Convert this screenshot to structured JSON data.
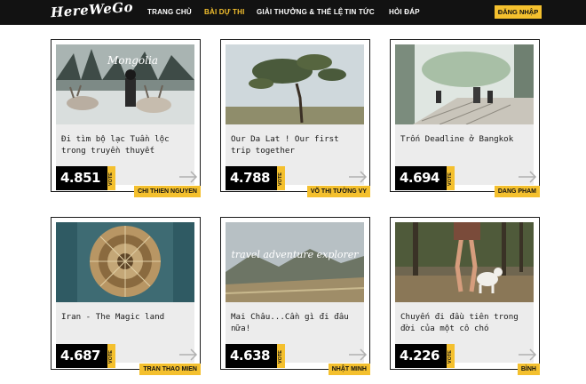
{
  "brand": {
    "logo_text": "HereWeGo"
  },
  "nav": {
    "items": [
      {
        "label": "TRANG CHỦ",
        "active": false
      },
      {
        "label": "BÀI DỰ THI",
        "active": true
      },
      {
        "label": "GIẢI THƯỞNG & THỂ LỆ",
        "active": false
      },
      {
        "label": "TIN TỨC",
        "active": false
      },
      {
        "label": "HỎI ĐÁP",
        "active": false
      }
    ],
    "login_label": "ĐĂNG NHẬP"
  },
  "colors": {
    "accent": "#f4c02e",
    "navbar": "#121212",
    "card_bg": "#ececec",
    "score_bg": "#000000"
  },
  "entries": [
    {
      "title": "Đi tìm bộ lạc Tuần lộc trong truyền thuyết",
      "score": "4.851",
      "vote_label": "VOTE",
      "author": "CHI THIEN NGUYEN",
      "photo_caption": "Mongolia",
      "photo_icon": "reindeer-photo"
    },
    {
      "title": "Our Da Lat ! Our first trip together",
      "score": "4.788",
      "vote_label": "VOTE",
      "author": "VÕ THỊ TƯỜNG VY",
      "photo_caption": "",
      "photo_icon": "pine-tree-photo"
    },
    {
      "title": "Trốn Deadline ở Bangkok",
      "score": "4.694",
      "vote_label": "VOTE",
      "author": "DANG PHAM",
      "photo_caption": "",
      "photo_icon": "cafe-garden-photo"
    },
    {
      "title": "Iran - The Magic land",
      "score": "4.687",
      "vote_label": "VOTE",
      "author": "TRAN THAO MIEN",
      "photo_caption": "",
      "photo_icon": "mosque-dome-photo"
    },
    {
      "title": "Mai Châu...Cần gì đi đâu nữa!",
      "score": "4.638",
      "vote_label": "VOTE",
      "author": "NHẬT MINH",
      "photo_caption": "travel adventure explorer",
      "photo_icon": "valley-photo"
    },
    {
      "title": "Chuyến đi đầu tiên trong đời của một cô chó",
      "score": "4.226",
      "vote_label": "VOTE",
      "author": "BÌNH",
      "photo_caption": "",
      "photo_icon": "dog-walk-photo"
    }
  ]
}
